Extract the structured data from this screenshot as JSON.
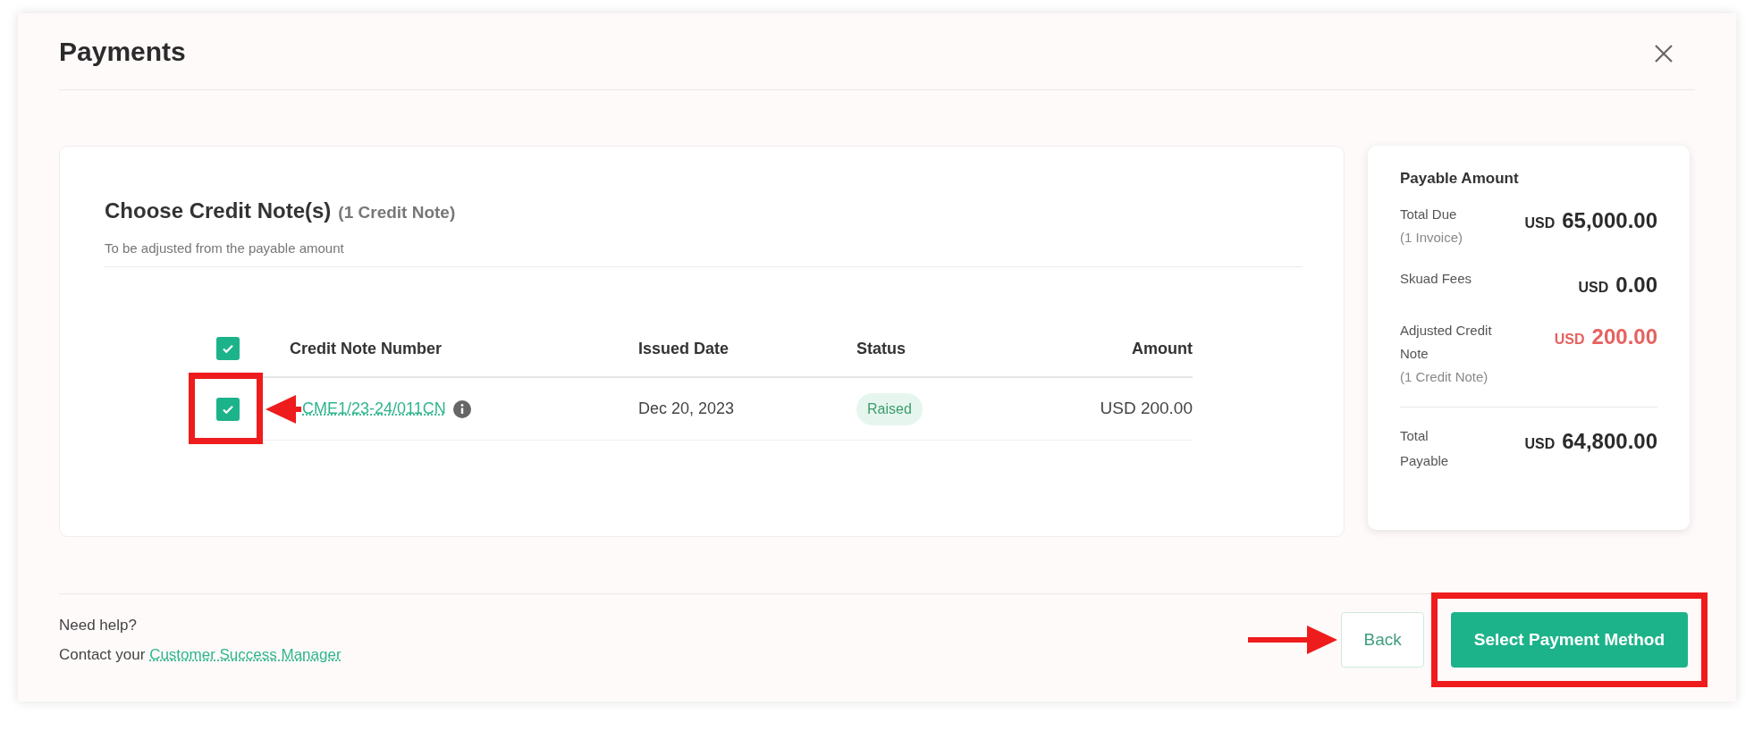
{
  "title": "Payments",
  "credit_notes": {
    "heading": "Choose Credit Note(s)",
    "count": "(1 Credit Note)",
    "subtitle": "To be adjusted from the payable amount",
    "select_all": {
      "checked": true
    },
    "columns": [
      "Credit Note Number",
      "Issued Date",
      "Status",
      "Amount"
    ],
    "rows": [
      {
        "checked": true,
        "number": "CME1/23-24/011CN",
        "date": "Dec 20, 2023",
        "status": "Raised",
        "amount": "USD 200.00"
      }
    ]
  },
  "summary": {
    "heading": "Payable Amount",
    "lines": [
      {
        "label": "Total Due",
        "note": "(1 Invoice)",
        "currency": "USD",
        "value": "65,000.00",
        "negative": false
      },
      {
        "label": "Skuad Fees",
        "currency": "USD",
        "value": "0.00",
        "negative": false
      },
      {
        "label": "Adjusted Credit Note",
        "note": "(1 Credit Note)",
        "currency": "USD",
        "value": "200.00",
        "negative": true
      }
    ],
    "total": {
      "label": "Total Payable",
      "currency": "USD",
      "value": "64,800.00"
    }
  },
  "help": {
    "question": "Need help?",
    "prefix": "Contact your",
    "link": "Customer Success Manager"
  },
  "buttons": [
    {
      "label": "Back",
      "kind": "secondary"
    },
    {
      "label": "Select Payment Method",
      "kind": "primary"
    }
  ]
}
